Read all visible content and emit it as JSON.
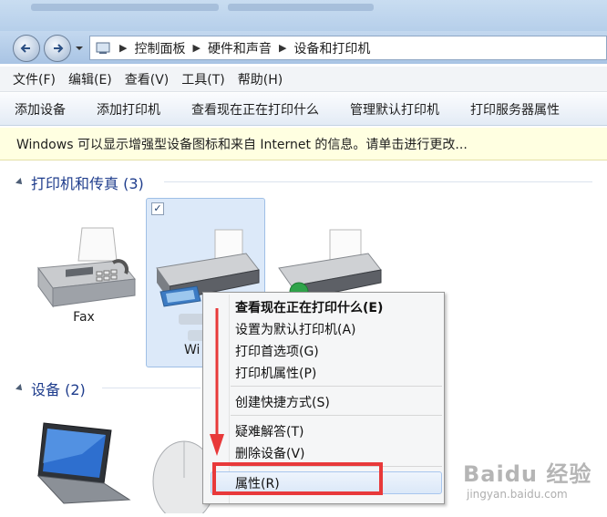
{
  "breadcrumb": [
    "控制面板",
    "硬件和声音",
    "设备和打印机"
  ],
  "menu": [
    "文件(F)",
    "编辑(E)",
    "查看(V)",
    "工具(T)",
    "帮助(H)"
  ],
  "commands": [
    "添加设备",
    "添加打印机",
    "查看现在正在打印什么",
    "管理默认打印机",
    "打印服务器属性"
  ],
  "info_bar": "Windows 可以显示增强型设备图标和来自 Internet 的信息。请单击进行更改...",
  "groups": {
    "printers": "打印机和传真 (3)",
    "devices": "设备 (2)"
  },
  "devices": {
    "fax": "Fax",
    "selected_printer_partial": "Wi",
    "selected_printer_blur": "HP OS"
  },
  "context_menu": {
    "items": [
      "查看现在正在打印什么(E)",
      "设置为默认打印机(A)",
      "打印首选项(G)",
      "打印机属性(P)",
      "创建快捷方式(S)",
      "疑难解答(T)",
      "删除设备(V)",
      "属性(R)"
    ]
  },
  "watermark": {
    "brand": "Baidu 经验",
    "url": "jingyan.baidu.com"
  },
  "colors": {
    "group_title": "#1e3c8c",
    "highlight_annotation": "#e8393a",
    "selection": "#dce9f9"
  }
}
